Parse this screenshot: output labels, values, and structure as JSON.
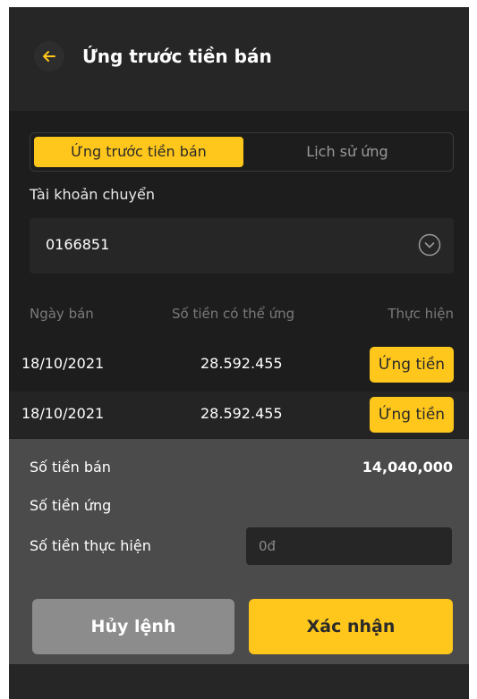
{
  "header": {
    "title": "Ứng trước tiền bán",
    "back_icon": "arrow-left-icon",
    "accent_color": "#ffc71b"
  },
  "tabs": [
    {
      "label": "Ứng trước tiền bán",
      "active": true
    },
    {
      "label": "Lịch sử ứng",
      "active": false
    }
  ],
  "account": {
    "label": "Tài khoản chuyển",
    "value": "0166851",
    "dropdown_icon": "chevron-down-circle-icon"
  },
  "table": {
    "headers": [
      "Ngày bán",
      "Số tiền có thể ứng",
      "Thực hiện"
    ],
    "rows": [
      {
        "date": "18/10/2021",
        "amount": "28.592.455",
        "action": "Ứng tiền"
      },
      {
        "date": "18/10/2021",
        "amount": "28.592.455",
        "action": "Ứng tiền"
      }
    ]
  },
  "summary": {
    "sale_amount_label": "Số tiền bán",
    "sale_amount_value": "14,040,000",
    "advance_amount_label": "Số tiền ứng",
    "execute_amount_label": "Số tiền thực hiện",
    "execute_amount_placeholder": "0đ"
  },
  "actions": {
    "cancel_label": "Hủy lệnh",
    "confirm_label": "Xác nhận"
  }
}
